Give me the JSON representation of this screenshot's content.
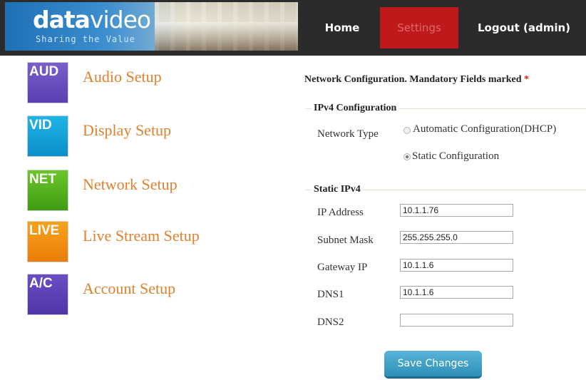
{
  "header": {
    "logo": {
      "brand_bold": "data",
      "brand_light": "video",
      "tagline": "Sharing the Value"
    },
    "nav": [
      {
        "label": "Home"
      },
      {
        "label": "Settings",
        "active": true
      },
      {
        "label": "Logout (admin)"
      }
    ]
  },
  "sidebar": {
    "items": [
      {
        "icon_text": "AUD",
        "label": "Audio Setup",
        "color": "#6a4ec0"
      },
      {
        "icon_text": "VID",
        "label": "Display Setup",
        "color": "#14a3d8"
      },
      {
        "icon_text": "NET",
        "label": "Network Setup",
        "color": "#55b11e"
      },
      {
        "icon_text": "LIVE",
        "label": "Live Stream Setup",
        "color": "#f08f12"
      },
      {
        "icon_text": "A/C",
        "label": "Account Setup",
        "color": "#5e40b7"
      }
    ]
  },
  "form": {
    "title": "Network Configuration. Mandatory Fields marked",
    "required_marker": "*",
    "ipv4_section": {
      "legend": "IPv4 Configuration",
      "network_type_label": "Network Type",
      "options": [
        {
          "label": "Automatic Configuration(DHCP)",
          "selected": false
        },
        {
          "label": "Static Configuration",
          "selected": true
        }
      ]
    },
    "static_section": {
      "legend": "Static IPv4",
      "fields": [
        {
          "label": "IP Address",
          "value": "10.1.1.76"
        },
        {
          "label": "Subnet Mask",
          "value": "255.255.255.0"
        },
        {
          "label": "Gateway IP",
          "value": "10.1.1.6"
        },
        {
          "label": "DNS1",
          "value": "10.1.1.6"
        },
        {
          "label": "DNS2",
          "value": ""
        }
      ]
    },
    "save_label": "Save Changes"
  },
  "colors": {
    "header_bg": "#2b2b2b",
    "nav_active_bg": "#c0191b",
    "sidebar_label": "#e0812e",
    "button": "#3fa3c9"
  }
}
